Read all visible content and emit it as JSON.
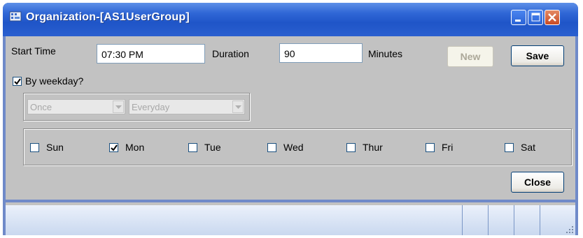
{
  "window": {
    "title": "Organization-[AS1UserGroup]"
  },
  "form": {
    "start_time_label": "Start Time",
    "start_time_value": "07:30 PM",
    "duration_label": "Duration",
    "duration_value": "90",
    "minutes_label": "Minutes",
    "new_button": "New",
    "save_button": "Save",
    "by_weekday_label": "By weekday?",
    "by_weekday_checked": true,
    "frequency_combo": "Once",
    "interval_combo": "Everyday",
    "close_button": "Close"
  },
  "days": [
    {
      "label": "Sun",
      "checked": false
    },
    {
      "label": "Mon",
      "checked": true
    },
    {
      "label": "Tue",
      "checked": false
    },
    {
      "label": "Wed",
      "checked": false
    },
    {
      "label": "Thur",
      "checked": false
    },
    {
      "label": "Fri",
      "checked": false
    },
    {
      "label": "Sat",
      "checked": false
    }
  ],
  "icons": [
    "window-app-icon",
    "minimize-icon",
    "maximize-icon",
    "close-icon",
    "checkmark-icon",
    "dropdown-arrow-icon",
    "resize-grip-icon"
  ],
  "colors": {
    "titlebar": "#245edb",
    "close_button": "#d5602f",
    "client_bg": "#c2c2c2",
    "status_bg": "#dde7f6"
  }
}
